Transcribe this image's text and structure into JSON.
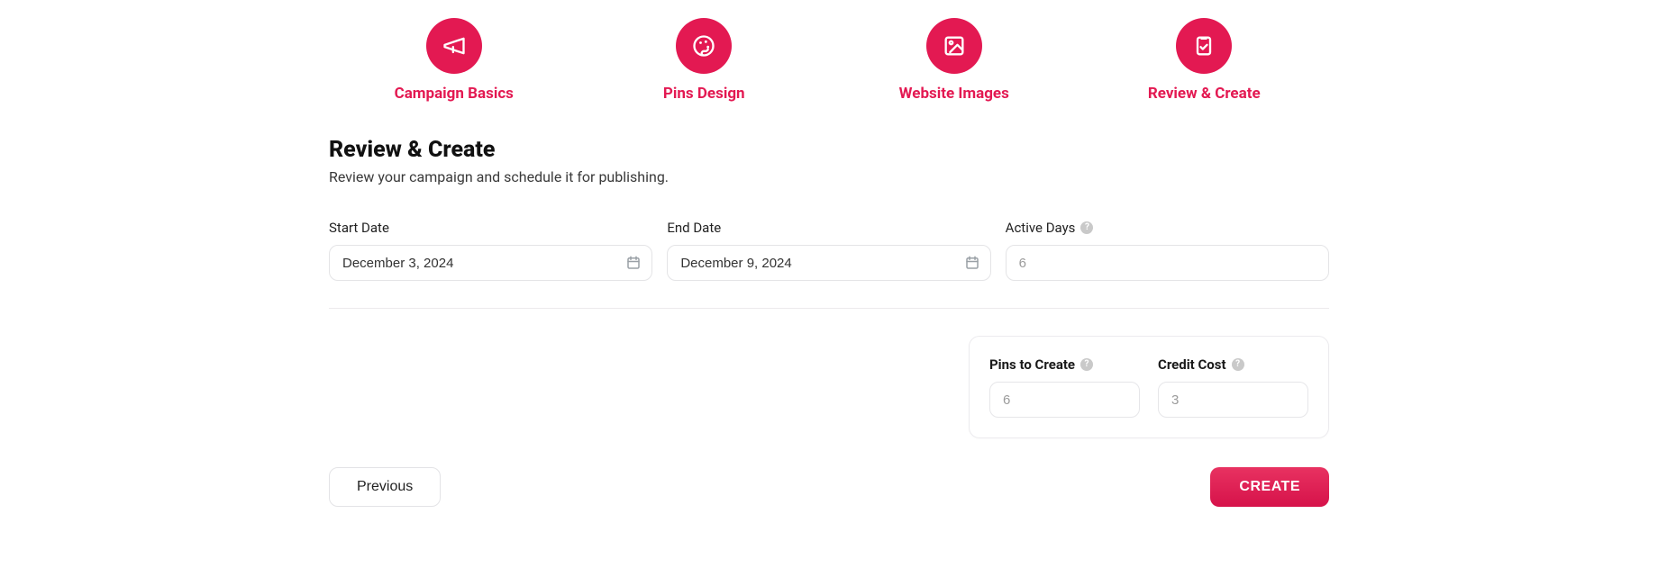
{
  "stepper": {
    "steps": [
      {
        "label": "Campaign Basics",
        "icon": "megaphone-icon"
      },
      {
        "label": "Pins Design",
        "icon": "palette-icon"
      },
      {
        "label": "Website Images",
        "icon": "image-icon"
      },
      {
        "label": "Review & Create",
        "icon": "clipboard-check-icon"
      }
    ]
  },
  "page": {
    "title": "Review & Create",
    "subtitle": "Review your campaign and schedule it for publishing."
  },
  "form": {
    "startDate": {
      "label": "Start Date",
      "value": "December 3, 2024"
    },
    "endDate": {
      "label": "End Date",
      "value": "December 9, 2024"
    },
    "activeDays": {
      "label": "Active Days",
      "value": "6"
    }
  },
  "summary": {
    "pinsToCreate": {
      "label": "Pins to Create",
      "value": "6"
    },
    "creditCost": {
      "label": "Credit Cost",
      "value": "3"
    }
  },
  "actions": {
    "previous": "Previous",
    "create": "CREATE"
  },
  "colors": {
    "accent": "#e31952"
  }
}
